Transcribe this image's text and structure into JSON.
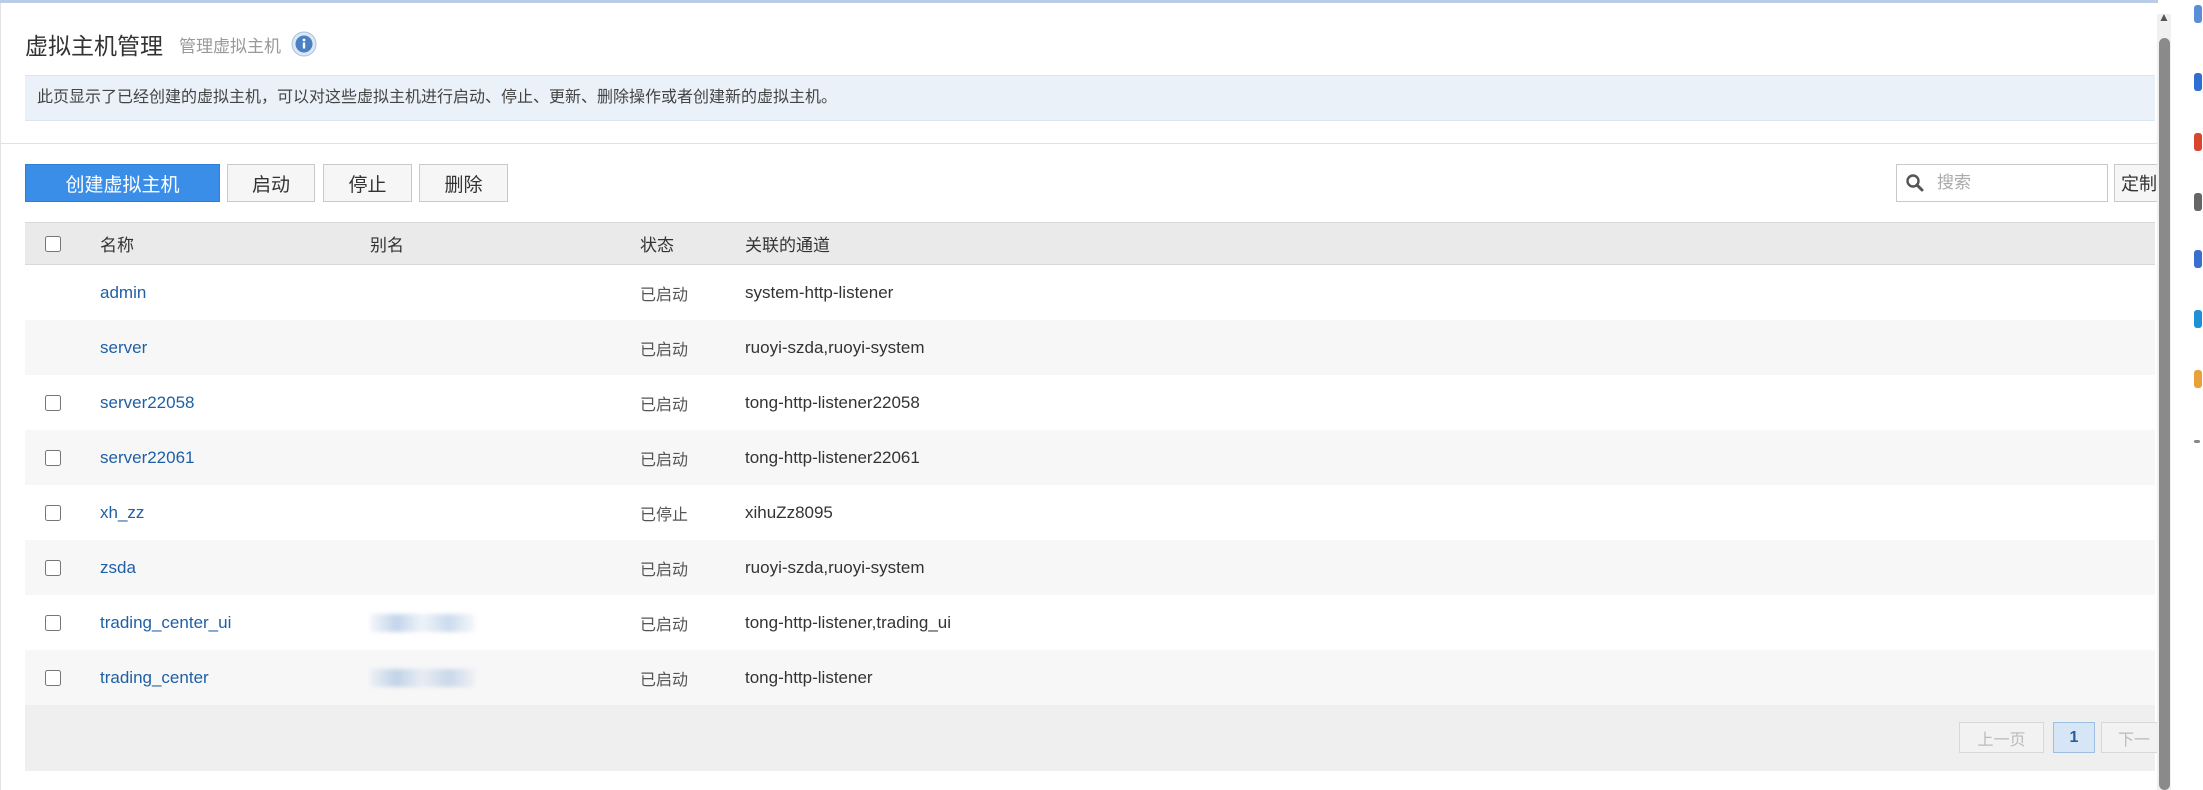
{
  "header": {
    "title": "虚拟主机管理",
    "subtitle": "管理虚拟主机",
    "description": "此页显示了已经创建的虚拟主机，可以对这些虚拟主机进行启动、停止、更新、删除操作或者创建新的虚拟主机。"
  },
  "toolbar": {
    "create_label": "创建虚拟主机",
    "start_label": "启动",
    "stop_label": "停止",
    "delete_label": "删除",
    "search_placeholder": "搜索",
    "custom_label": "定制"
  },
  "table": {
    "columns": {
      "name": "名称",
      "alias": "别名",
      "status": "状态",
      "channel": "关联的通道"
    },
    "rows": [
      {
        "name": "admin",
        "status": "已启动",
        "channel": "system-http-listener",
        "checkbox": false,
        "alias_redacted": false
      },
      {
        "name": "server",
        "status": "已启动",
        "channel": "ruoyi-szda,ruoyi-system",
        "checkbox": false,
        "alias_redacted": false
      },
      {
        "name": "server22058",
        "status": "已启动",
        "channel": "tong-http-listener22058",
        "checkbox": true,
        "alias_redacted": false
      },
      {
        "name": "server22061",
        "status": "已启动",
        "channel": "tong-http-listener22061",
        "checkbox": true,
        "alias_redacted": false
      },
      {
        "name": "xh_zz",
        "status": "已停止",
        "channel": "xihuZz8095",
        "checkbox": true,
        "alias_redacted": false
      },
      {
        "name": "zsda",
        "status": "已启动",
        "channel": "ruoyi-szda,ruoyi-system",
        "checkbox": true,
        "alias_redacted": false
      },
      {
        "name": "trading_center_ui",
        "status": "已启动",
        "channel": "tong-http-listener,trading_ui",
        "checkbox": true,
        "alias_redacted": true
      },
      {
        "name": "trading_center",
        "status": "已启动",
        "channel": "tong-http-listener",
        "checkbox": true,
        "alias_redacted": true
      }
    ]
  },
  "pagination": {
    "prev_label": "上一页",
    "current_page": "1",
    "next_label": "下一"
  },
  "colors": {
    "primary": "#3b8ee8",
    "link": "#1f5fa6",
    "info_bar": "#eaf1f9"
  }
}
